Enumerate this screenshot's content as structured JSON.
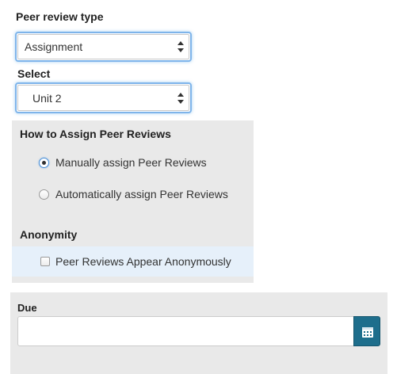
{
  "peer_review_type": {
    "label": "Peer review type",
    "selected": "Assignment"
  },
  "select": {
    "label": "Select",
    "selected": "Unit 2"
  },
  "assign": {
    "heading": "How to Assign Peer Reviews",
    "options": [
      {
        "label": "Manually assign Peer Reviews",
        "checked": true
      },
      {
        "label": "Automatically assign Peer Reviews",
        "checked": false
      }
    ]
  },
  "anonymity": {
    "heading": "Anonymity",
    "checkbox_label": "Peer Reviews Appear Anonymously",
    "checked": false
  },
  "due": {
    "label": "Due",
    "value": "",
    "calendar_icon": "calendar-icon"
  },
  "colors": {
    "focus_border": "#7eb4ea",
    "panel_gray": "#e9e9e9",
    "highlight_row": "#e6f0fa",
    "calendar_button": "#1e6e8c"
  }
}
